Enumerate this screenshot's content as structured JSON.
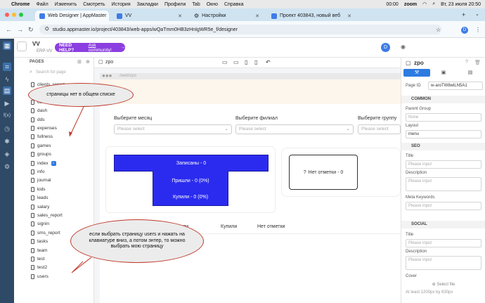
{
  "menubar": {
    "app": "Chrome",
    "items": [
      "Файл",
      "Изменить",
      "Смотреть",
      "История",
      "Закладки",
      "Профили",
      "Tab",
      "Окно",
      "Справка"
    ],
    "time_left": "00:00",
    "zoom": "zoom",
    "datetime": "Вт, 23 июля 20:50"
  },
  "tabs": [
    {
      "label": "Web Designer | AppMaster",
      "color": "#3f7be6"
    },
    {
      "label": "VV",
      "color": "#3f7be6"
    },
    {
      "label": "Настройки",
      "color": "#5a8ad6"
    },
    {
      "label": "Проект 403843, новый веб",
      "color": "#3f7be6"
    }
  ],
  "address": {
    "url": "studio.appmaster.io/project/403843/web-apps/wQaTmm0HB3zHnIgWR5e_f/designer"
  },
  "topbar": {
    "project": "VV",
    "subtitle": "ERP-VV",
    "help_label": "NEED HELP?",
    "help_link": "Ask community!",
    "avatar": "D",
    "canvas_tab": "zpo"
  },
  "pages": {
    "header": "PAGES",
    "search_placeholder": "Search for page",
    "items": [
      "clients_report",
      "cli",
      "co",
      "dash",
      "dds",
      "expenses",
      "fullness",
      "games",
      "groups",
      "index",
      "info",
      "journal",
      "kids",
      "leads",
      "salary",
      "sales_report",
      "signin",
      "sms_report",
      "tasks",
      "team",
      "test",
      "test2",
      "users"
    ]
  },
  "canvas": {
    "browser_url": "/web/zpo",
    "select1_label": "Выберите месяц",
    "select2_label": "Выберите филиал",
    "select3_label": "Выберите группу",
    "placeholder": "Please select",
    "bar_registered": "Записаны - 0",
    "bar_came": "Пришли - 0 (0%)",
    "bar_bought": "Купили - 0 (0%)",
    "no_mark": "Нет отметки -  0",
    "tab_bought": "Купили",
    "tab_nomark": "Нет отметки",
    "tab_cut": "ли"
  },
  "bubbles": {
    "b1": "страницы нет в общем списке",
    "b2": "если выбрать страницу users и нажать на клавиатуре вниз, а потом энтер, то можно выбрать мою страницу"
  },
  "right": {
    "title": "zpo",
    "page_id_label": "Page ID",
    "page_id": "w-aroTW8wlLN5A1",
    "sec_common": "COMMON",
    "parent_group": "Parent Group",
    "parent_value": "None",
    "layout_label": "Layout",
    "layout_value": "menu",
    "sec_seo": "SEO",
    "title_label": "Title",
    "input_ph": "Please input",
    "description_label": "Description",
    "meta_label": "Meta Keywords",
    "sec_social": "SOCIAL",
    "title2_label": "Title",
    "description2_label": "Description",
    "cover_label": "Cover",
    "select_file": "Select file",
    "hint": "At least 1200px by 630px"
  },
  "colors": {
    "accent": "#2b2bf0",
    "help": "#8c3fe0",
    "rail": "#2f4a66"
  }
}
